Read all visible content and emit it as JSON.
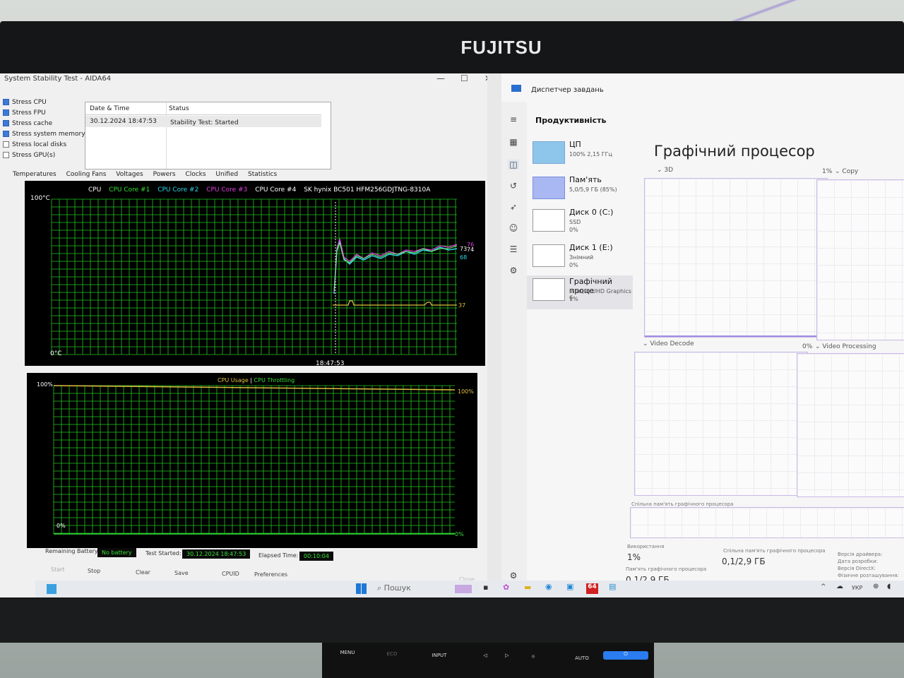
{
  "monitor": {
    "brand": "FUJITSU",
    "buttons": [
      "MENU",
      "ECO",
      "INPUT",
      "◁",
      "▷",
      "☼",
      "AUTO",
      "⏻"
    ]
  },
  "aida": {
    "title": "System Stability Test - AIDA64",
    "stress_options": [
      {
        "label": "Stress CPU",
        "checked": true
      },
      {
        "label": "Stress FPU",
        "checked": true
      },
      {
        "label": "Stress cache",
        "checked": true
      },
      {
        "label": "Stress system memory",
        "checked": true
      },
      {
        "label": "Stress local disks",
        "checked": false
      },
      {
        "label": "Stress GPU(s)",
        "checked": false
      }
    ],
    "table": {
      "col1": "Date & Time",
      "col2": "Status",
      "row_date": "30.12.2024 18:47:53",
      "row_status": "Stability Test: Started"
    },
    "tabs": [
      "Temperatures",
      "Cooling Fans",
      "Voltages",
      "Powers",
      "Clocks",
      "Unified",
      "Statistics"
    ],
    "temp_legend": [
      {
        "label": "CPU",
        "color": "#ffffff"
      },
      {
        "label": "CPU Core #1",
        "color": "#35e035"
      },
      {
        "label": "CPU Core #2",
        "color": "#2fd7e8"
      },
      {
        "label": "CPU Core #3",
        "color": "#e040e0"
      },
      {
        "label": "CPU Core #4",
        "color": "#ffffff"
      },
      {
        "label": "SK hynix BC501 HFM256GDJTNG-8310A",
        "color": "#ffffff"
      }
    ],
    "temp_axis_top": "100°C",
    "temp_axis_bottom": "0°C",
    "temp_time": "18:47:53",
    "temp_values": [
      "76",
      "74",
      "73",
      "68",
      "37"
    ],
    "usage_legend_a": "CPU Usage",
    "usage_legend_sep": "|",
    "usage_legend_b": "CPU Throttling",
    "usage_axis_top": "100%",
    "usage_axis_bottom": "0%",
    "usage_right_top": "100%",
    "usage_right_bottom": "0%",
    "remaining_battery_label": "Remaining Battery:",
    "remaining_battery_value": "No battery",
    "test_started_label": "Test Started:",
    "test_started_value": "30.12.2024 18:47:53",
    "elapsed_label": "Elapsed Time:",
    "elapsed_value": "00:10:04",
    "buttons": [
      "Start",
      "Stop",
      "Clear",
      "Save",
      "CPUID",
      "Preferences",
      "Close"
    ]
  },
  "taskmgr": {
    "title": "Диспетчер завдань",
    "section": "Продуктивність",
    "items": [
      {
        "name": "ЦП",
        "sub1": "100% 2,15 ГГц",
        "sub2": ""
      },
      {
        "name": "Пам'ять",
        "sub1": "5,0/5,9 ГБ (85%)",
        "sub2": ""
      },
      {
        "name": "Диск 0 (C:)",
        "sub1": "SSD",
        "sub2": "0%"
      },
      {
        "name": "Диск 1 (E:)",
        "sub1": "Знімний",
        "sub2": "0%"
      },
      {
        "name": "Графічний проце",
        "sub1": "Intel(R) UHD Graphics 6",
        "sub2": "1%"
      }
    ],
    "gpu_title": "Графічний процесор",
    "engine_3d": "3D",
    "engine_3d_pct": "1%",
    "engine_copy": "Copy",
    "engine_vdecode": "Video Decode",
    "engine_vdecode_pct": "0%",
    "engine_vproc": "Video Processing",
    "shared_mem_label": "Спільна пам'ять графічного процесора",
    "usage_label": "Використання",
    "usage_value": "1%",
    "shared_label2": "Спільна пам'ять графічного процесора",
    "shared_value": "0,1/2,9 ГБ",
    "gpu_mem_label": "Пам'ять графічного процесора",
    "gpu_mem_value": "0,1/2,9 ГБ",
    "driver_version": "Версія драйвера:",
    "driver_date": "Дата розробки:",
    "directx": "Версія DirectX:",
    "location": "Фізичне розташування:"
  },
  "taskbar": {
    "search": "Пошук",
    "lang": "УКР"
  },
  "colors": {
    "grid_green": "#22c422",
    "line_yellow": "#e0c040",
    "aida_bg": "#f0f0f0"
  }
}
